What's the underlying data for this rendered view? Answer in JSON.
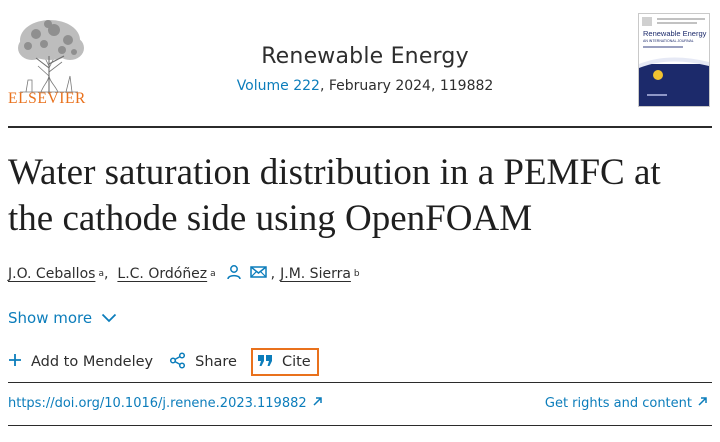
{
  "header": {
    "publisher_name": "ELSEVIER",
    "journal_title": "Renewable Energy",
    "volume_label": "Volume 222",
    "issue_info": ", February 2024, 119882",
    "cover": {
      "title": "Renewable Energy",
      "subtitle": "AN INTERNATIONAL JOURNAL"
    }
  },
  "article": {
    "title": "Water saturation distribution in a PEMFC at the cathode side using OpenFOAM",
    "authors": [
      {
        "name": "J.O. Ceballos",
        "aff": "a"
      },
      {
        "name": "L.C. Ordóñez",
        "aff": "a"
      },
      {
        "name": "J.M. Sierra",
        "aff": "b"
      }
    ],
    "author_separator": ",",
    "show_more_label": "Show more"
  },
  "toolbar": {
    "add_label": "Add to Mendeley",
    "share_label": "Share",
    "cite_label": "Cite"
  },
  "links": {
    "doi": "https://doi.org/10.1016/j.renene.2023.119882",
    "rights": "Get rights and content"
  },
  "colors": {
    "link": "#0c7dbb",
    "publisher_orange": "#e9711c",
    "cover_blue": "#1c2a6b"
  },
  "icons": {
    "author_profile": "person-icon",
    "author_email": "envelope-icon",
    "show_more": "chevron-down-icon",
    "add": "plus-icon",
    "share": "share-icon",
    "cite": "quote-icon",
    "external": "arrow-up-right-icon"
  }
}
